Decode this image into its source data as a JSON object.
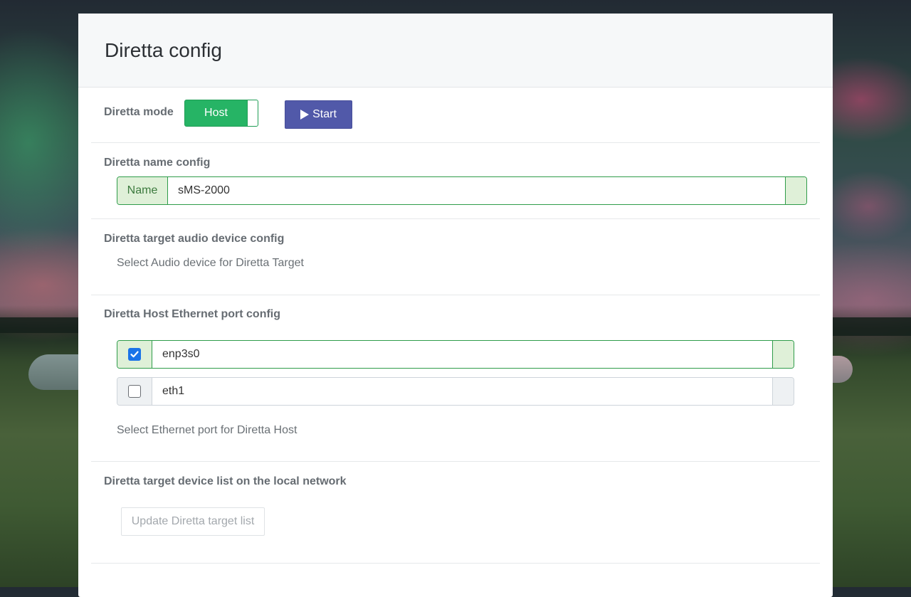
{
  "card": {
    "title": "Diretta config"
  },
  "mode": {
    "label": "Diretta mode",
    "toggle_label": "Host",
    "toggle_on": true,
    "start_label": "Start"
  },
  "name_config": {
    "label": "Diretta name config",
    "addon": "Name",
    "value": "sMS-2000"
  },
  "target_audio": {
    "label": "Diretta target audio device config",
    "hint": "Select Audio device for Diretta Target"
  },
  "ethernet": {
    "label": "Diretta Host Ethernet port config",
    "ports": [
      {
        "name": "enp3s0",
        "checked": true
      },
      {
        "name": "eth1",
        "checked": false
      }
    ],
    "hint": "Select Ethernet port for Diretta Host"
  },
  "target_list": {
    "label": "Diretta target device list on the local network",
    "button": "Update Diretta target list"
  },
  "colors": {
    "toggle_green": "#26b465",
    "start_button": "#5159a9",
    "input_border": "#2f9c4a",
    "addon_bg": "#dff0d8",
    "checkbox_blue": "#1a73e8"
  }
}
